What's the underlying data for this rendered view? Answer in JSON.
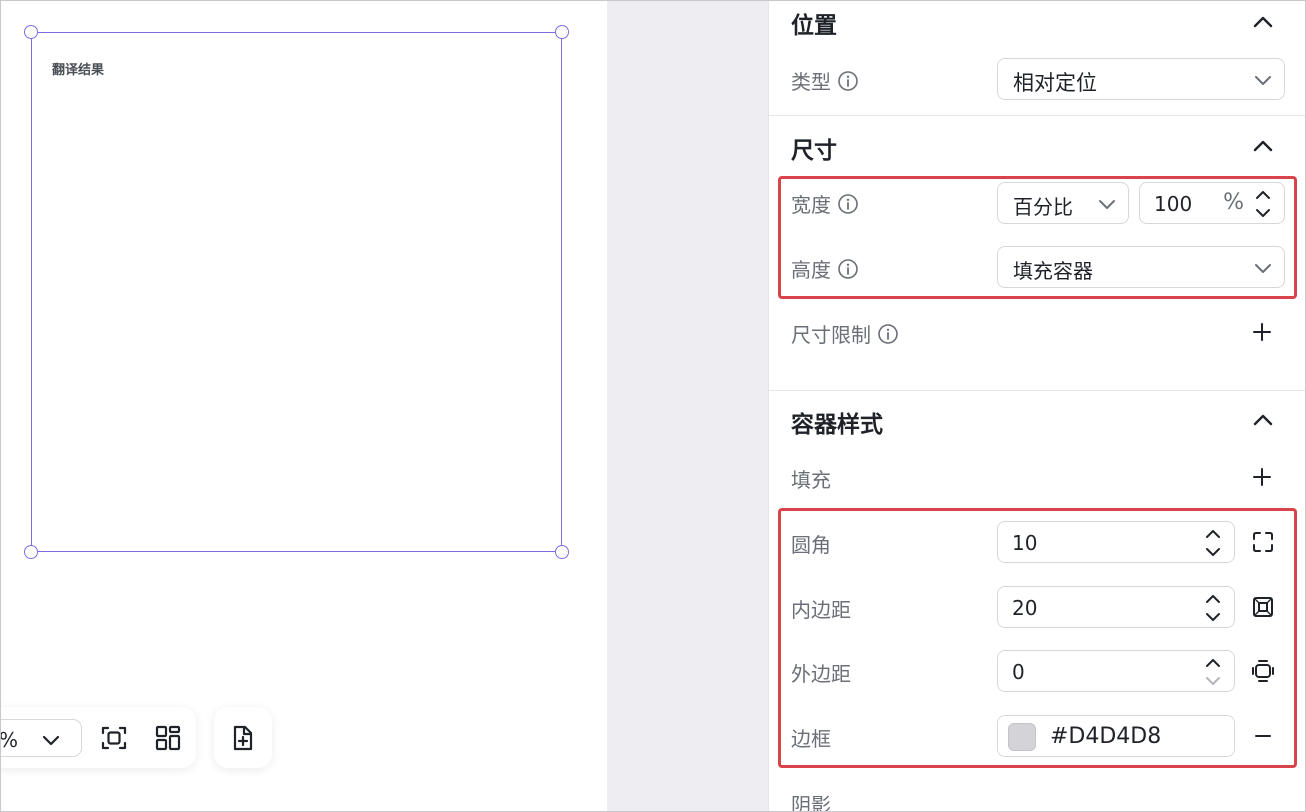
{
  "canvas": {
    "box_title": "翻译结果",
    "toolbar": {
      "zoom_value": "%"
    }
  },
  "panel": {
    "position": {
      "title": "位置",
      "type_label": "类型",
      "type_value": "相对定位"
    },
    "size": {
      "title": "尺寸",
      "width_label": "宽度",
      "width_mode": "百分比",
      "width_value": "100",
      "width_unit": "%",
      "height_label": "高度",
      "height_value": "填充容器",
      "limit_label": "尺寸限制"
    },
    "container_style": {
      "title": "容器样式",
      "fill_label": "填充",
      "radius_label": "圆角",
      "radius_value": "10",
      "padding_label": "内边距",
      "padding_value": "20",
      "margin_label": "外边距",
      "margin_value": "0",
      "border_label": "边框",
      "border_color": "#D4D4D8",
      "shadow_label": "阴影"
    }
  },
  "colors": {
    "selection": "#7b6fe0",
    "highlight": "#d9444a",
    "swatch": "#d4d4d8"
  }
}
